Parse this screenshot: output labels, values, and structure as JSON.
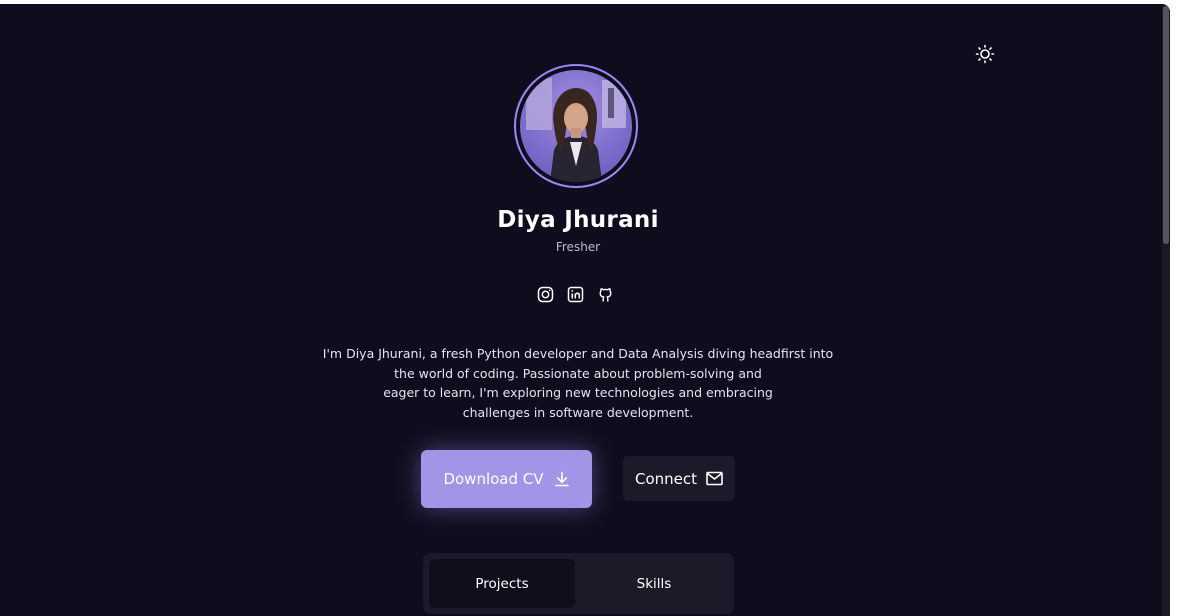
{
  "profile": {
    "name": "Diya Jhurani",
    "role": "Fresher",
    "bio_lines": [
      "I'm Diya Jhurani, a fresh Python developer and Data Analysis diving headfirst into",
      "the world of coding. Passionate about problem-solving and",
      "eager to learn, I'm exploring new technologies and embracing",
      "challenges in software development."
    ]
  },
  "icons": {
    "theme_toggle": "sun-icon",
    "socials": [
      "instagram-icon",
      "linkedin-icon",
      "github-icon"
    ],
    "download": "download-icon",
    "connect": "mail-icon"
  },
  "buttons": {
    "download_cv": "Download CV",
    "connect": "Connect"
  },
  "tabs": {
    "items": [
      "Projects",
      "Skills"
    ],
    "active": "Projects"
  },
  "colors": {
    "background": "#0f0d1d",
    "accent": "#9b87f5",
    "primary_button": "#a195e8",
    "surface": "#1c1a28"
  }
}
